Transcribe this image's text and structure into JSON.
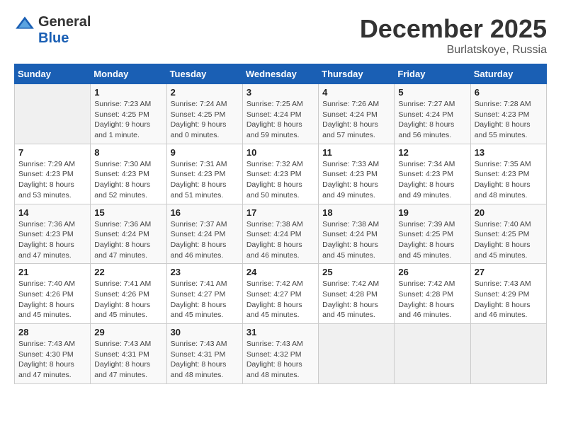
{
  "header": {
    "logo_general": "General",
    "logo_blue": "Blue",
    "month_title": "December 2025",
    "location": "Burlatskoye, Russia"
  },
  "weekdays": [
    "Sunday",
    "Monday",
    "Tuesday",
    "Wednesday",
    "Thursday",
    "Friday",
    "Saturday"
  ],
  "weeks": [
    [
      {
        "day": "",
        "info": ""
      },
      {
        "day": "1",
        "info": "Sunrise: 7:23 AM\nSunset: 4:25 PM\nDaylight: 9 hours\nand 1 minute."
      },
      {
        "day": "2",
        "info": "Sunrise: 7:24 AM\nSunset: 4:25 PM\nDaylight: 9 hours\nand 0 minutes."
      },
      {
        "day": "3",
        "info": "Sunrise: 7:25 AM\nSunset: 4:24 PM\nDaylight: 8 hours\nand 59 minutes."
      },
      {
        "day": "4",
        "info": "Sunrise: 7:26 AM\nSunset: 4:24 PM\nDaylight: 8 hours\nand 57 minutes."
      },
      {
        "day": "5",
        "info": "Sunrise: 7:27 AM\nSunset: 4:24 PM\nDaylight: 8 hours\nand 56 minutes."
      },
      {
        "day": "6",
        "info": "Sunrise: 7:28 AM\nSunset: 4:23 PM\nDaylight: 8 hours\nand 55 minutes."
      }
    ],
    [
      {
        "day": "7",
        "info": "Sunrise: 7:29 AM\nSunset: 4:23 PM\nDaylight: 8 hours\nand 53 minutes."
      },
      {
        "day": "8",
        "info": "Sunrise: 7:30 AM\nSunset: 4:23 PM\nDaylight: 8 hours\nand 52 minutes."
      },
      {
        "day": "9",
        "info": "Sunrise: 7:31 AM\nSunset: 4:23 PM\nDaylight: 8 hours\nand 51 minutes."
      },
      {
        "day": "10",
        "info": "Sunrise: 7:32 AM\nSunset: 4:23 PM\nDaylight: 8 hours\nand 50 minutes."
      },
      {
        "day": "11",
        "info": "Sunrise: 7:33 AM\nSunset: 4:23 PM\nDaylight: 8 hours\nand 49 minutes."
      },
      {
        "day": "12",
        "info": "Sunrise: 7:34 AM\nSunset: 4:23 PM\nDaylight: 8 hours\nand 49 minutes."
      },
      {
        "day": "13",
        "info": "Sunrise: 7:35 AM\nSunset: 4:23 PM\nDaylight: 8 hours\nand 48 minutes."
      }
    ],
    [
      {
        "day": "14",
        "info": "Sunrise: 7:36 AM\nSunset: 4:23 PM\nDaylight: 8 hours\nand 47 minutes."
      },
      {
        "day": "15",
        "info": "Sunrise: 7:36 AM\nSunset: 4:24 PM\nDaylight: 8 hours\nand 47 minutes."
      },
      {
        "day": "16",
        "info": "Sunrise: 7:37 AM\nSunset: 4:24 PM\nDaylight: 8 hours\nand 46 minutes."
      },
      {
        "day": "17",
        "info": "Sunrise: 7:38 AM\nSunset: 4:24 PM\nDaylight: 8 hours\nand 46 minutes."
      },
      {
        "day": "18",
        "info": "Sunrise: 7:38 AM\nSunset: 4:24 PM\nDaylight: 8 hours\nand 45 minutes."
      },
      {
        "day": "19",
        "info": "Sunrise: 7:39 AM\nSunset: 4:25 PM\nDaylight: 8 hours\nand 45 minutes."
      },
      {
        "day": "20",
        "info": "Sunrise: 7:40 AM\nSunset: 4:25 PM\nDaylight: 8 hours\nand 45 minutes."
      }
    ],
    [
      {
        "day": "21",
        "info": "Sunrise: 7:40 AM\nSunset: 4:26 PM\nDaylight: 8 hours\nand 45 minutes."
      },
      {
        "day": "22",
        "info": "Sunrise: 7:41 AM\nSunset: 4:26 PM\nDaylight: 8 hours\nand 45 minutes."
      },
      {
        "day": "23",
        "info": "Sunrise: 7:41 AM\nSunset: 4:27 PM\nDaylight: 8 hours\nand 45 minutes."
      },
      {
        "day": "24",
        "info": "Sunrise: 7:42 AM\nSunset: 4:27 PM\nDaylight: 8 hours\nand 45 minutes."
      },
      {
        "day": "25",
        "info": "Sunrise: 7:42 AM\nSunset: 4:28 PM\nDaylight: 8 hours\nand 45 minutes."
      },
      {
        "day": "26",
        "info": "Sunrise: 7:42 AM\nSunset: 4:28 PM\nDaylight: 8 hours\nand 46 minutes."
      },
      {
        "day": "27",
        "info": "Sunrise: 7:43 AM\nSunset: 4:29 PM\nDaylight: 8 hours\nand 46 minutes."
      }
    ],
    [
      {
        "day": "28",
        "info": "Sunrise: 7:43 AM\nSunset: 4:30 PM\nDaylight: 8 hours\nand 47 minutes."
      },
      {
        "day": "29",
        "info": "Sunrise: 7:43 AM\nSunset: 4:31 PM\nDaylight: 8 hours\nand 47 minutes."
      },
      {
        "day": "30",
        "info": "Sunrise: 7:43 AM\nSunset: 4:31 PM\nDaylight: 8 hours\nand 48 minutes."
      },
      {
        "day": "31",
        "info": "Sunrise: 7:43 AM\nSunset: 4:32 PM\nDaylight: 8 hours\nand 48 minutes."
      },
      {
        "day": "",
        "info": ""
      },
      {
        "day": "",
        "info": ""
      },
      {
        "day": "",
        "info": ""
      }
    ]
  ]
}
